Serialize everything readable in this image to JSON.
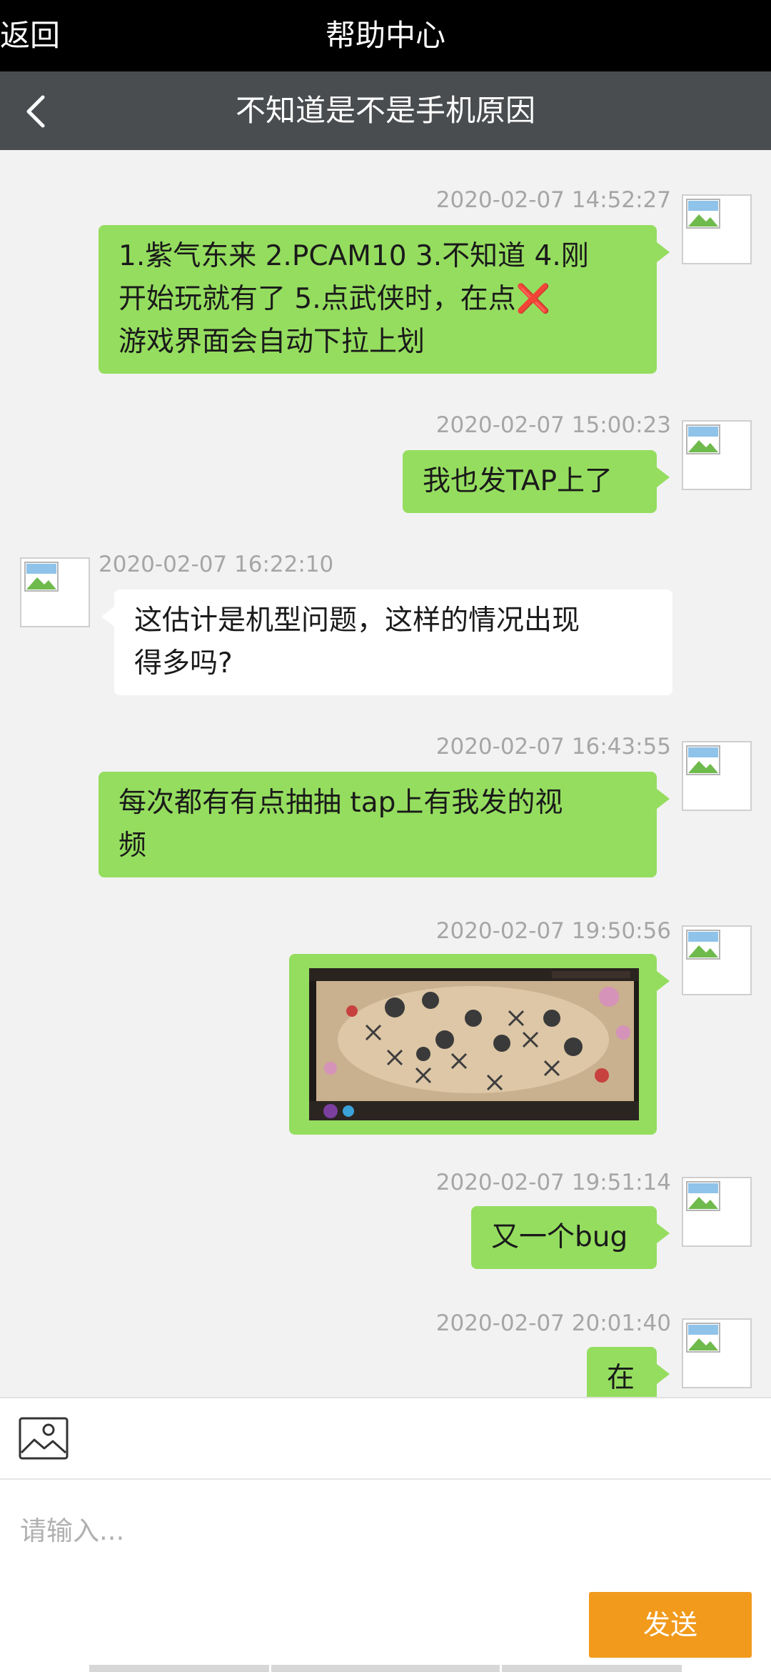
{
  "topbar": {
    "back_label": "返回",
    "title": "帮助中心"
  },
  "subbar": {
    "title": "不知道是不是手机原因"
  },
  "messages": [
    {
      "timestamp": "2020-02-07 14:52:27",
      "sender": "me",
      "text": "1.紫气东来 2.PCAM10 3.不知道 4.刚开始玩就有了 5.点武侠时，在点❌游戏界面会自动下拉上划"
    },
    {
      "timestamp": "2020-02-07 15:00:23",
      "sender": "me",
      "text": "我也发TAP上了"
    },
    {
      "timestamp": "2020-02-07 16:22:10",
      "sender": "them",
      "text": "这估计是机型问题，这样的情况出现得多吗?"
    },
    {
      "timestamp": "2020-02-07 16:43:55",
      "sender": "me",
      "text": "每次都有有点抽抽 tap上有我发的视频"
    },
    {
      "timestamp": "2020-02-07 19:50:56",
      "sender": "me",
      "type": "image",
      "text": ""
    },
    {
      "timestamp": "2020-02-07 19:51:14",
      "sender": "me",
      "text": "又一个bug"
    },
    {
      "timestamp": "2020-02-07 20:01:40",
      "sender": "me",
      "text": "在"
    }
  ],
  "msg1_parts": {
    "line1": "1.紫气东来 2.PCAM10 3.不知道 4.刚",
    "line2a": "开始玩就有了 5.点武侠时，在点",
    "x": "❌",
    "line3": "游戏界面会自动下拉上划"
  },
  "msg3_parts": {
    "line1": "这估计是机型问题，这样的情况出现",
    "line2": "得多吗?"
  },
  "msg4_parts": {
    "line1": "每次都有有点抽抽 tap上有我发的视",
    "line2": "频"
  },
  "composer": {
    "placeholder": "请输入...",
    "send_label": "发送"
  },
  "colors": {
    "me_bubble": "#95dd5f",
    "them_bubble": "#ffffff",
    "send_button": "#f19a1c",
    "topbar": "#000000",
    "subbar": "#4a4d50"
  },
  "icons": {
    "back": "chevron-left-icon",
    "image": "image-picker-icon",
    "avatar": "broken-image-avatar"
  }
}
